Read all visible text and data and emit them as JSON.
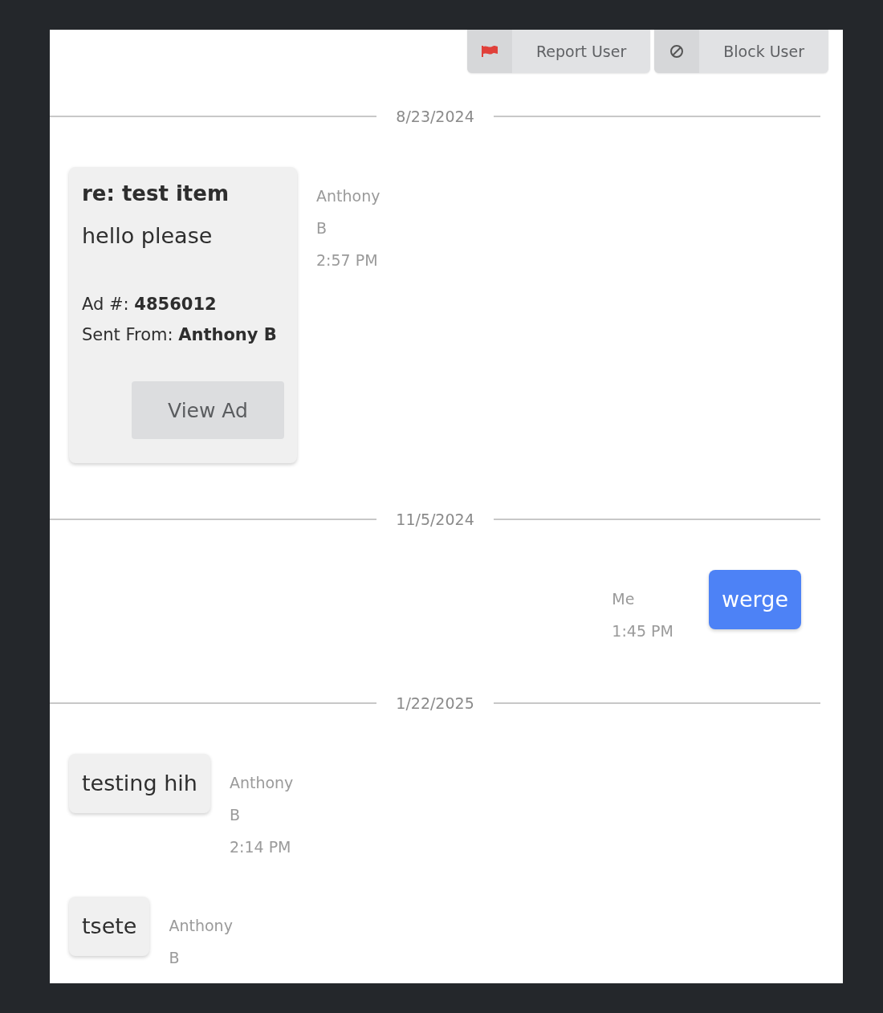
{
  "actions": [
    {
      "kind": "report",
      "label": "Report User"
    },
    {
      "kind": "block",
      "label": "Block User"
    }
  ],
  "days": [
    {
      "date": "8/23/2024",
      "messages": [
        {
          "kind": "ad",
          "outgoing": false,
          "title": "re: test item",
          "text": "hello please",
          "ad_line": "Ad #: **4856012**",
          "from_line": "Sent From: **Anthony B**",
          "button": "View Ad",
          "sender": "Anthony B",
          "time": "2:57 PM"
        }
      ]
    },
    {
      "date": "11/5/2024",
      "messages": [
        {
          "kind": "text",
          "outgoing": true,
          "text": "werge",
          "sender": "Me",
          "time": "1:45 PM"
        }
      ]
    },
    {
      "date": "1/22/2025",
      "messages": [
        {
          "kind": "text",
          "outgoing": false,
          "text": "testing hih",
          "sender": "Anthony B",
          "time": "2:14 PM"
        },
        {
          "kind": "text",
          "outgoing": false,
          "text": "tsete",
          "sender": "Anthony B"
        }
      ]
    }
  ]
}
